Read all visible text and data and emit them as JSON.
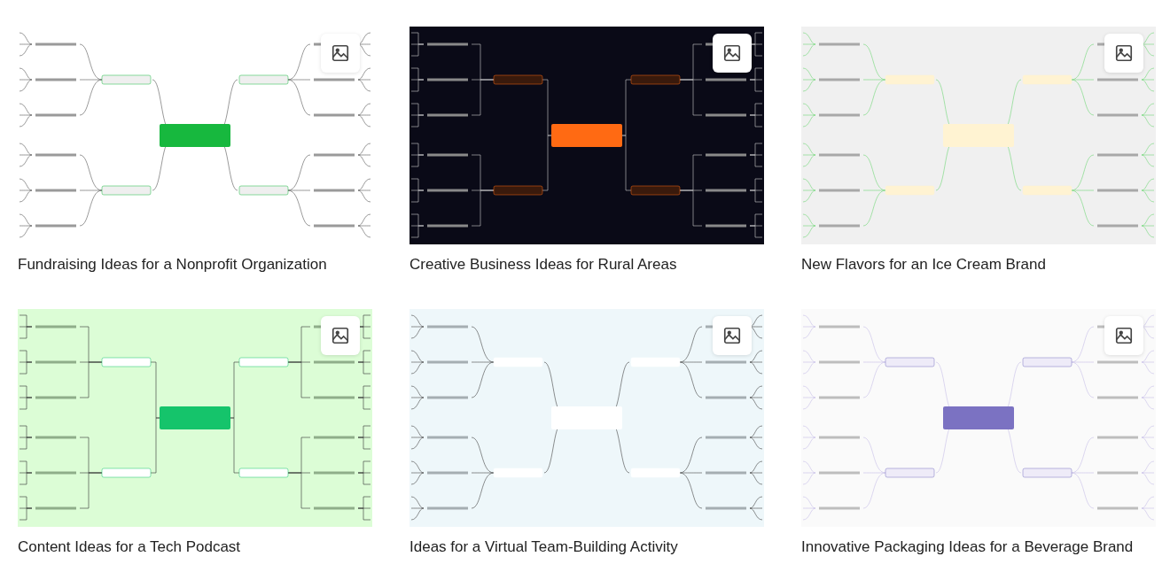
{
  "cards": [
    {
      "title": "Fundraising Ideas for a Nonprofit Organization"
    },
    {
      "title": "Creative Business Ideas for Rural Areas"
    },
    {
      "title": "New Flavors for an Ice Cream Brand"
    },
    {
      "title": "Content Ideas for a Tech Podcast"
    },
    {
      "title": "Ideas for a Virtual Team-Building Activity"
    },
    {
      "title": "Innovative Packaging Ideas for a Beverage Brand"
    }
  ]
}
